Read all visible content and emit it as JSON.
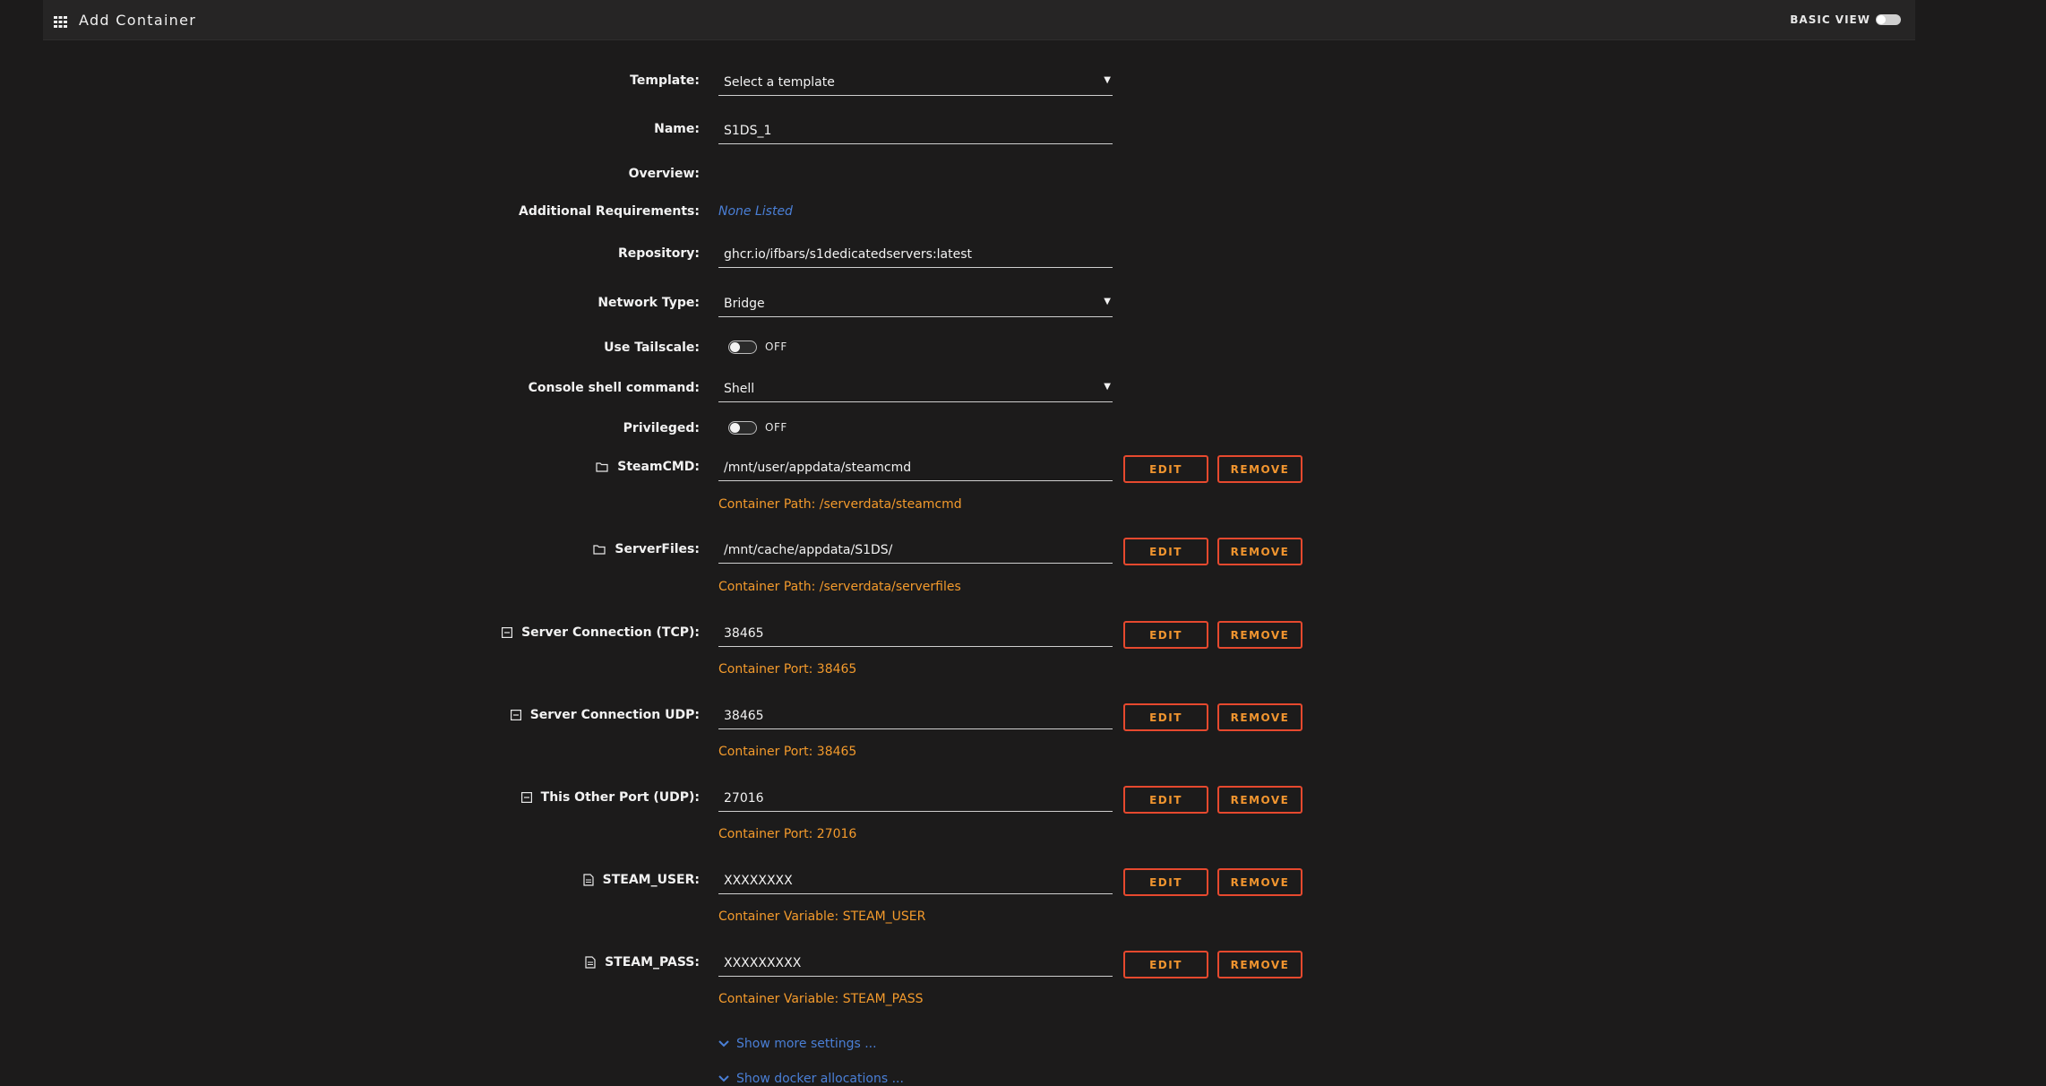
{
  "header": {
    "title": "Add Container",
    "basic_view_label": "BASIC VIEW",
    "icon": "grid-icon"
  },
  "template": {
    "label": "Template:",
    "value": "Select a template"
  },
  "name": {
    "label": "Name:",
    "value": "S1DS_1"
  },
  "overview": {
    "label": "Overview:"
  },
  "additional": {
    "label": "Additional Requirements:",
    "value": "None Listed"
  },
  "repository": {
    "label": "Repository:",
    "value": "ghcr.io/ifbars/s1dedicatedservers:latest"
  },
  "network": {
    "label": "Network Type:",
    "value": "Bridge"
  },
  "tailscale": {
    "label": "Use Tailscale:",
    "state": "OFF"
  },
  "console": {
    "label": "Console shell command:",
    "value": "Shell"
  },
  "privileged": {
    "label": "Privileged:",
    "state": "OFF"
  },
  "buttons": {
    "edit": "EDIT",
    "remove": "REMOVE"
  },
  "configs": [
    {
      "icon": "folder-icon",
      "label": "SteamCMD:",
      "value": "/mnt/user/appdata/steamcmd",
      "sub": "Container Path: /serverdata/steamcmd"
    },
    {
      "icon": "folder-icon",
      "label": "ServerFiles:",
      "value": "/mnt/cache/appdata/S1DS/",
      "sub": "Container Path: /serverdata/serverfiles"
    },
    {
      "icon": "port-icon",
      "label": "Server Connection (TCP):",
      "value": "38465",
      "sub": "Container Port: 38465"
    },
    {
      "icon": "port-icon",
      "label": "Server Connection UDP:",
      "value": "38465",
      "sub": "Container Port: 38465"
    },
    {
      "icon": "port-icon",
      "label": "This Other Port (UDP):",
      "value": "27016",
      "sub": "Container Port: 27016"
    },
    {
      "icon": "variable-icon",
      "label": "STEAM_USER:",
      "value": "XXXXXXXX",
      "sub": "Container Variable: STEAM_USER"
    },
    {
      "icon": "variable-icon",
      "label": "STEAM_PASS:",
      "value": "XXXXXXXXX",
      "sub": "Container Variable: STEAM_PASS"
    }
  ],
  "links": {
    "more": "Show more settings ...",
    "docker": "Show docker allocations ..."
  },
  "colors": {
    "background": "#1c1b1b",
    "accent_orange": "#f39a2c",
    "button_border": "#e6492e",
    "link_blue": "#4a7fd6"
  }
}
